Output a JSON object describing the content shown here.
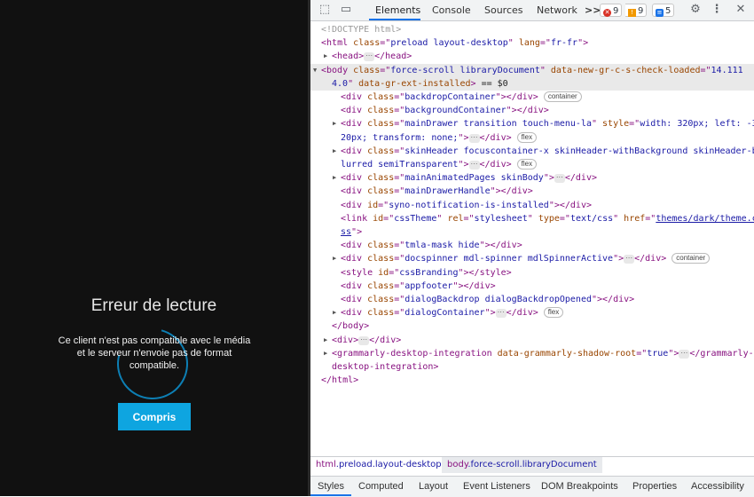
{
  "app": {
    "dialog": {
      "title": "Erreur de lecture",
      "message": "Ce client n'est pas compatible avec le média et le serveur n'envoie pas de format compatible.",
      "button_label": "Compris"
    },
    "colors": {
      "background": "#111111",
      "accent": "#0ea5e0"
    }
  },
  "devtools": {
    "tabs": [
      "Elements",
      "Console",
      "Sources",
      "Network"
    ],
    "more_tabs": ">>",
    "errors_count": "9",
    "warnings_count": "9",
    "messages_count": "5",
    "dom_lines": [
      {
        "indent": 0,
        "html": "<span class='cmt'>&lt;!DOCTYPE html&gt;</span>"
      },
      {
        "indent": 0,
        "html": "&lt;<span class='tag'>html</span> <span class='an'>class</span>=\"<span class='av'>preload layout-desktop</span>\" <span class='an'>lang</span>=\"<span class='av'>fr-fr</span>\"&gt;"
      },
      {
        "indent": 1,
        "arrow": "▶",
        "html": "&lt;head&gt;<span class='dots'>···</span>&lt;/head&gt;"
      },
      {
        "indent": 0,
        "arrow": "▼",
        "selected": true,
        "html": "&lt;body <span class='an'>class</span>=\"<span class='av'>force-scroll libraryDocument</span>\" <span class='an'>data-new-gr-c-s-check-loaded</span>=\"<span class='av'>14.111</span>"
      },
      {
        "indent": 0,
        "selected": true,
        "html": "<span class='av'>4.0</span>\" <span class='an'>data-gr-ext-installed</span>&gt; <span class='txt'>== $0</span>"
      },
      {
        "indent": 2,
        "html": "&lt;div <span class='an'>class</span>=\"<span class='av'>backdropContainer</span>\"&gt;&lt;/div&gt; <span class='pill'>container</span>"
      },
      {
        "indent": 2,
        "html": "&lt;div <span class='an'>class</span>=\"<span class='av'>backgroundContainer</span>\"&gt;&lt;/div&gt;"
      },
      {
        "indent": 2,
        "arrow": "▶",
        "html": "&lt;div <span class='an'>class</span>=\"<span class='av'>mainDrawer transition touch-menu-la</span>\" <span class='an'>style</span>=\"<span class='av'>width: 320px; left: -3</span>"
      },
      {
        "indent": 2,
        "html": "<span class='av'>20px; transform: none;</span>\"&gt;<span class='dots'>···</span>&lt;/div&gt; <span class='pill'>flex</span>"
      },
      {
        "indent": 2,
        "arrow": "▶",
        "html": "&lt;div <span class='an'>class</span>=\"<span class='av'>skinHeader focuscontainer-x skinHeader-withBackground skinHeader-b</span>"
      },
      {
        "indent": 2,
        "html": "<span class='av'>lurred semiTransparent</span>\"&gt;<span class='dots'>···</span>&lt;/div&gt; <span class='pill'>flex</span>"
      },
      {
        "indent": 2,
        "arrow": "▶",
        "html": "&lt;div <span class='an'>class</span>=\"<span class='av'>mainAnimatedPages skinBody</span>\"&gt;<span class='dots'>···</span>&lt;/div&gt;"
      },
      {
        "indent": 2,
        "html": "&lt;div <span class='an'>class</span>=\"<span class='av'>mainDrawerHandle</span>\"&gt;&lt;/div&gt;"
      },
      {
        "indent": 2,
        "html": "&lt;div <span class='an'>id</span>=\"<span class='av'>syno-notification-is-installed</span>\"&gt;&lt;/div&gt;"
      },
      {
        "indent": 2,
        "html": "&lt;link <span class='an'>id</span>=\"<span class='av'>cssTheme</span>\" <span class='an'>rel</span>=\"<span class='av'>stylesheet</span>\" <span class='an'>type</span>=\"<span class='av'>text/css</span>\" <span class='an'>href</span>=\"<span class='link'>themes/dark/theme.c</span>"
      },
      {
        "indent": 2,
        "html": "<span class='link'>ss</span>\"&gt;"
      },
      {
        "indent": 2,
        "html": "&lt;div <span class='an'>class</span>=\"<span class='av'>tmla-mask hide</span>\"&gt;&lt;/div&gt;"
      },
      {
        "indent": 2,
        "arrow": "▶",
        "html": "&lt;div <span class='an'>class</span>=\"<span class='av'>docspinner mdl-spinner mdlSpinnerActive</span>\"&gt;<span class='dots'>···</span>&lt;/div&gt; <span class='pill'>container</span>"
      },
      {
        "indent": 2,
        "html": "&lt;style <span class='an'>id</span>=\"<span class='av'>cssBranding</span>\"&gt;&lt;/style&gt;"
      },
      {
        "indent": 2,
        "html": "&lt;div <span class='an'>class</span>=\"<span class='av'>appfooter</span>\"&gt;&lt;/div&gt;"
      },
      {
        "indent": 2,
        "html": "&lt;div <span class='an'>class</span>=\"<span class='av'>dialogBackdrop dialogBackdropOpened</span>\"&gt;&lt;/div&gt;"
      },
      {
        "indent": 2,
        "arrow": "▶",
        "html": "&lt;div <span class='an'>class</span>=\"<span class='av'>dialogContainer</span>\"&gt;<span class='dots'>···</span>&lt;/div&gt; <span class='pill'>flex</span>"
      },
      {
        "indent": 1,
        "html": "&lt;/body&gt;"
      },
      {
        "indent": 1,
        "arrow": "▶",
        "html": "&lt;div&gt;<span class='dots'>···</span>&lt;/div&gt;"
      },
      {
        "indent": 1,
        "arrow": "▶",
        "html": "&lt;grammarly-desktop-integration <span class='an'>data-grammarly-shadow-root</span>=\"<span class='av'>true</span>\"&gt;<span class='dots'>···</span>&lt;/grammarly-"
      },
      {
        "indent": 1,
        "html": "desktop-integration&gt;"
      },
      {
        "indent": 0,
        "html": "&lt;/html&gt;"
      }
    ],
    "breadcrumbs": [
      {
        "tag": "html",
        "cls": ".preload.layout-desktop"
      },
      {
        "tag": "body",
        "cls": ".force-scroll.libraryDocument"
      }
    ],
    "bottom_tabs": [
      "Styles",
      "Computed",
      "Layout",
      "Event Listeners",
      "DOM Breakpoints",
      "Properties",
      "Accessibility"
    ]
  }
}
